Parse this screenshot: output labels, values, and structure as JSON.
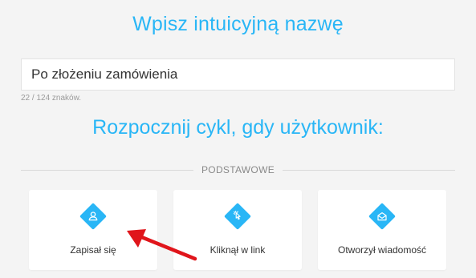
{
  "heading": "Wpisz intuicyjną nazwę",
  "name_field": {
    "value": "Po złożeniu zamówienia",
    "counter": "22 / 124 znaków."
  },
  "subheading": "Rozpocznij cykl, gdy użytkownik:",
  "section_label": "PODSTAWOWE",
  "cards": [
    {
      "label": "Zapisał się",
      "icon": "user-icon"
    },
    {
      "label": "Kliknął w link",
      "icon": "click-icon"
    },
    {
      "label": "Otworzył wiadomość",
      "icon": "envelope-open-icon"
    }
  ],
  "colors": {
    "accent": "#29b6f6",
    "arrow": "#e0151b",
    "background": "#f4f4f4"
  }
}
